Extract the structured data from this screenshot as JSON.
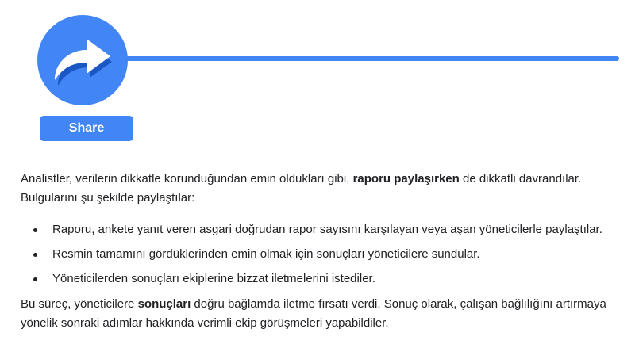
{
  "hero": {
    "icon": "share-arrow-icon",
    "share_label": "Share",
    "accent_color": "#4285f4"
  },
  "content": {
    "para1": {
      "before": "Analistler, verilerin dikkatle korunduğundan emin oldukları gibi, ",
      "bold": "raporu paylaşırken",
      "after": " de dikkatli davrandılar. Bulgularını şu şekilde paylaştılar:"
    },
    "bullets": [
      "Raporu, ankete yanıt veren asgari doğrudan rapor sayısını karşılayan veya aşan yöneticilerle paylaştılar.",
      "Resmin tamamını gördüklerinden emin olmak için sonuçları yöneticilere sundular.",
      "Yöneticilerden sonuçları ekiplerine bizzat iletmelerini istediler."
    ],
    "para2": {
      "before": "Bu süreç, yöneticilere ",
      "bold": "sonuçları",
      "after": " doğru bağlamda iletme fırsatı verdi. Sonuç olarak, çalışan bağlılığını artırmaya yönelik sonraki adımlar hakkında verimli ekip görüşmeleri yapabildiler."
    }
  }
}
